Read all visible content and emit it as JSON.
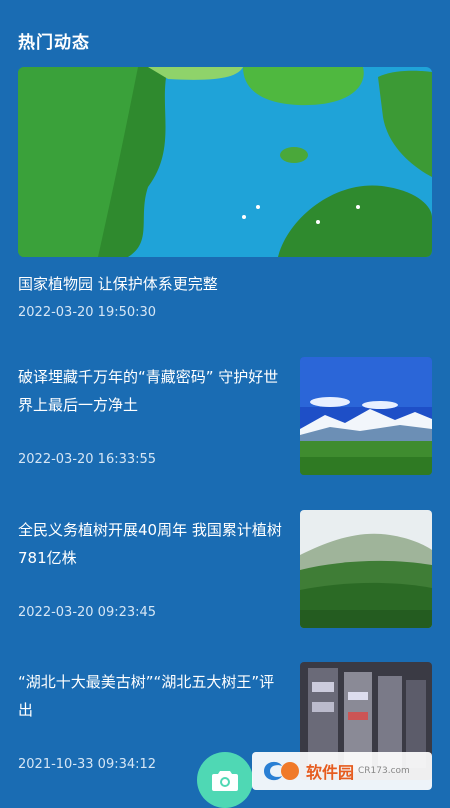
{
  "section": {
    "title": "热门动态"
  },
  "featured": {
    "title": "国家植物园 让保护体系更完整",
    "time": "2022-03-20 19:50:30",
    "image": "aerial-lake-forest"
  },
  "news": [
    {
      "title": "破译埋藏千万年的“青藏密码” 守护好世界上最后一方净土",
      "time": "2022-03-20 16:33:55",
      "image": "snow-mountain-grassland"
    },
    {
      "title": "全民义务植树开展40周年 我国累计植树781亿株",
      "time": "2022-03-20 09:23:45",
      "image": "misty-forest"
    },
    {
      "title": "“湖北十大最美古树”“湖北五大树王”评出",
      "time": "2021-10-33 09:34:12",
      "image": "storage-shelves"
    }
  ],
  "fab": {
    "icon": "camera-icon"
  },
  "watermark": {
    "text": "软件园",
    "sub": "CR173.com"
  },
  "colors": {
    "background": "#1a6cb3",
    "fab": "#4fd8b4"
  }
}
